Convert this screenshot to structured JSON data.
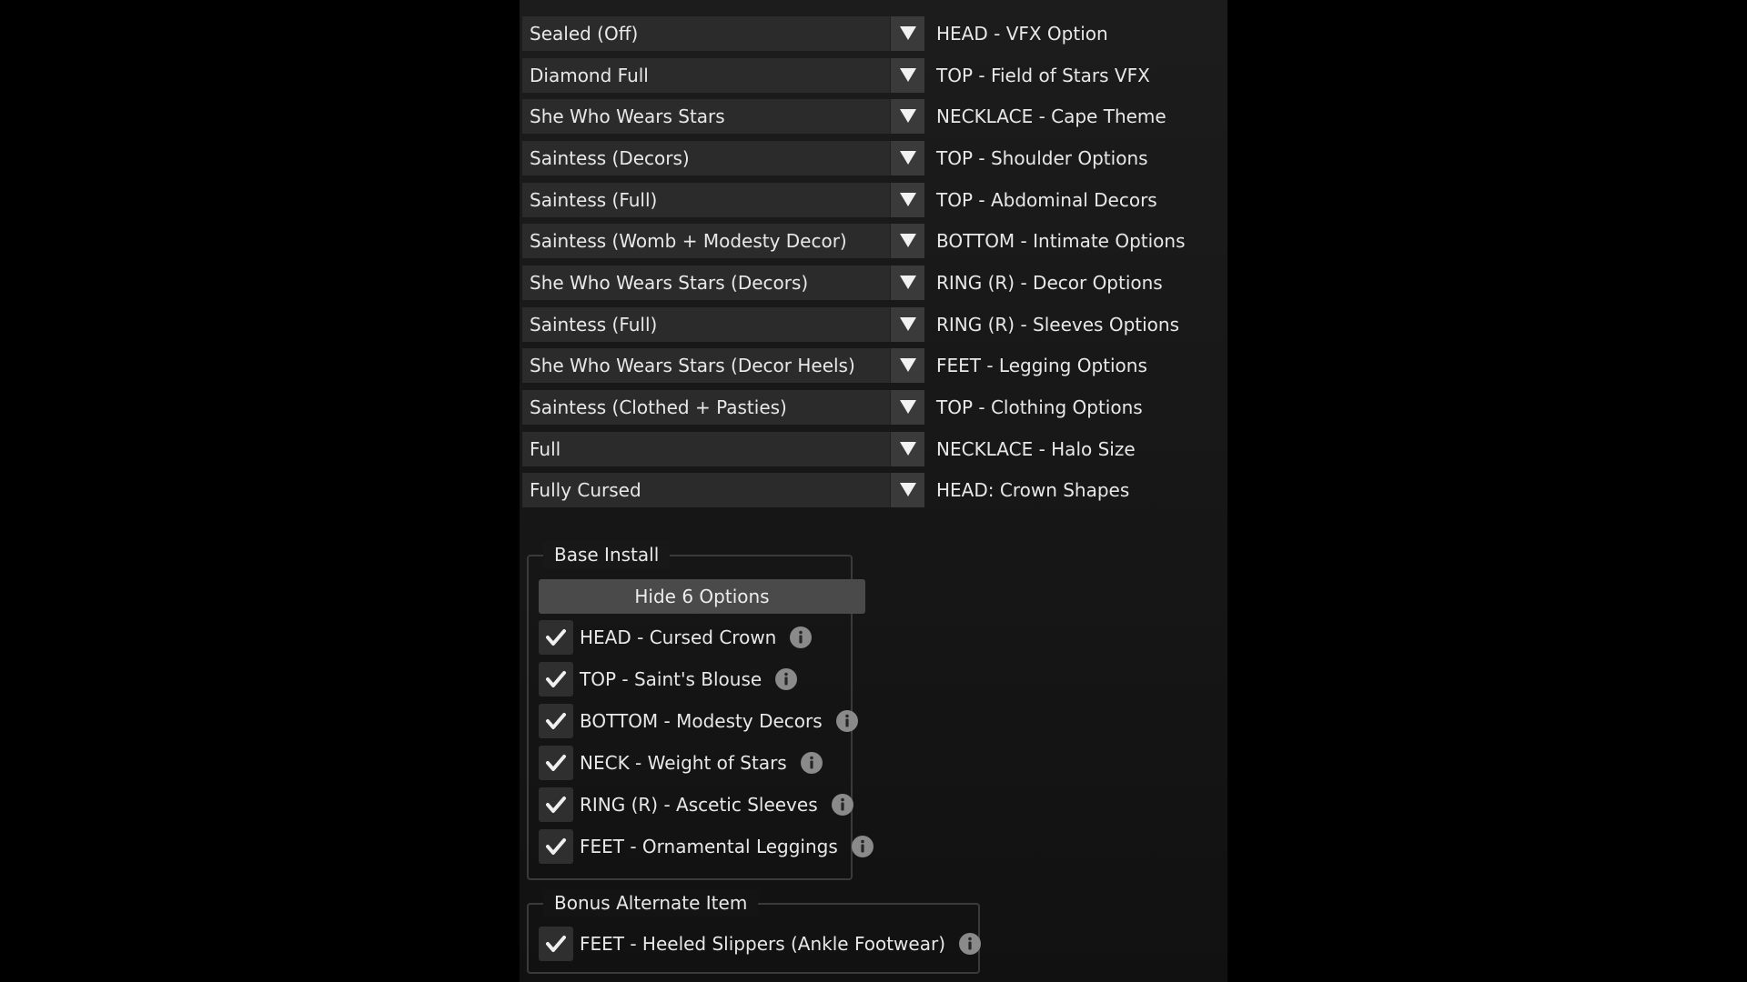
{
  "options": [
    {
      "value": "Sealed (Off)",
      "label": "HEAD - VFX Option"
    },
    {
      "value": "Diamond Full",
      "label": "TOP - Field of Stars VFX"
    },
    {
      "value": "She Who Wears Stars",
      "label": "NECKLACE - Cape Theme"
    },
    {
      "value": "Saintess (Decors)",
      "label": "TOP - Shoulder Options"
    },
    {
      "value": "Saintess (Full)",
      "label": "TOP - Abdominal Decors"
    },
    {
      "value": "Saintess (Womb + Modesty Decor)",
      "label": "BOTTOM - Intimate Options"
    },
    {
      "value": "She Who Wears Stars (Decors)",
      "label": "RING (R) - Decor Options"
    },
    {
      "value": "Saintess (Full)",
      "label": "RING (R) - Sleeves Options"
    },
    {
      "value": "She Who Wears Stars (Decor Heels)",
      "label": "FEET - Legging Options"
    },
    {
      "value": "Saintess (Clothed + Pasties)",
      "label": "TOP - Clothing Options"
    },
    {
      "value": "Full",
      "label": "NECKLACE - Halo Size"
    },
    {
      "value": "Fully Cursed",
      "label": "HEAD: Crown Shapes"
    }
  ],
  "base_install": {
    "title": "Base Install",
    "hide_button_label": "Hide 6 Options",
    "items": [
      {
        "label": "HEAD - Cursed Crown",
        "checked": true
      },
      {
        "label": "TOP - Saint's Blouse",
        "checked": true
      },
      {
        "label": "BOTTOM - Modesty Decors",
        "checked": true
      },
      {
        "label": "NECK - Weight of Stars",
        "checked": true
      },
      {
        "label": "RING (R) - Ascetic Sleeves",
        "checked": true
      },
      {
        "label": "FEET - Ornamental Leggings",
        "checked": true
      }
    ]
  },
  "bonus_alternate": {
    "title": "Bonus Alternate Item",
    "items": [
      {
        "label": "FEET - Heeled Slippers (Ankle Footwear)",
        "checked": true
      }
    ]
  },
  "icons": {
    "dropdown": "chevron-down-icon",
    "check": "checkmark-icon",
    "info": "info-icon"
  },
  "colors": {
    "background": "#000000",
    "panel": "#1a1a1a",
    "select": "#2b2b2b",
    "button": "#4a4a4a",
    "text": "#e8e8e8"
  }
}
